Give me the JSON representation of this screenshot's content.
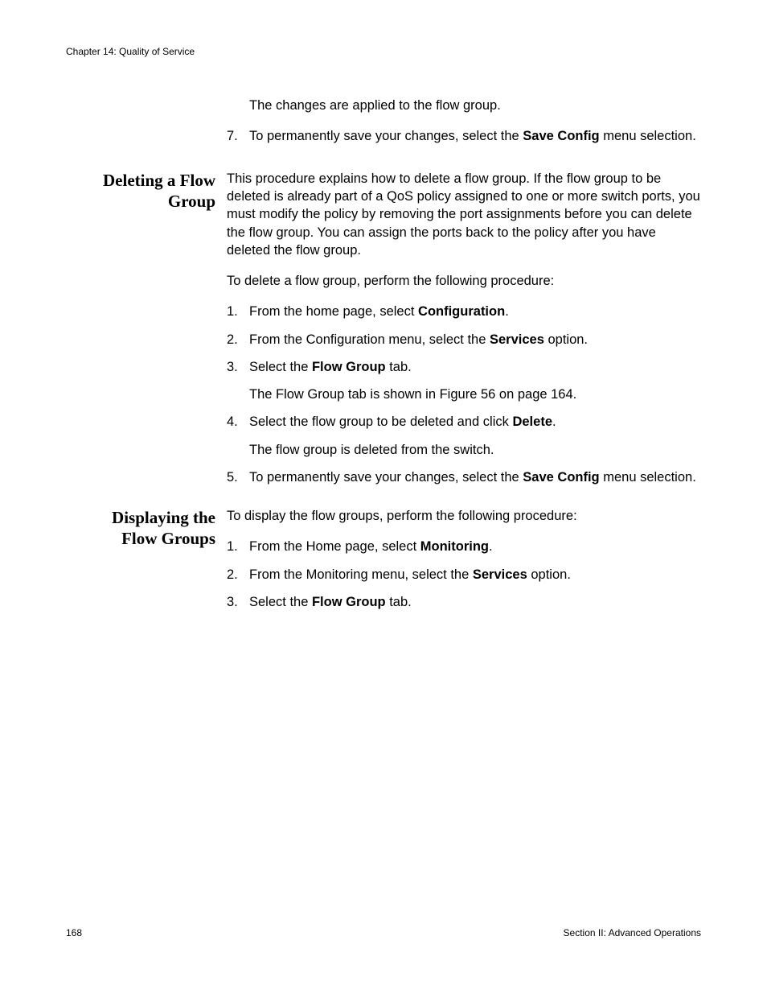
{
  "header": {
    "running": "Chapter 14: Quality of Service"
  },
  "intro": {
    "applied": "The changes are applied to the flow group.",
    "step7": {
      "num": "7.",
      "pre": "To permanently save your changes, select the ",
      "bold": "Save Config",
      "post": " menu selection."
    }
  },
  "section1": {
    "heading_l1": "Deleting a Flow",
    "heading_l2": "Group",
    "para": "This procedure explains how to delete a flow group. If the flow group to be deleted is already part of a QoS policy assigned to one or more switch ports, you must modify the policy by removing the port assignments before you can delete the flow group. You can assign the ports back to the policy after you have deleted the flow group.",
    "lead": "To delete a flow group, perform the following procedure:",
    "s1": {
      "num": "1.",
      "pre": "From the home page, select ",
      "bold": "Configuration",
      "post": "."
    },
    "s2": {
      "num": "2.",
      "pre": "From the Configuration menu, select the ",
      "bold": "Services",
      "post": " option."
    },
    "s3": {
      "num": "3.",
      "pre": "Select the ",
      "bold": "Flow Group",
      "post": " tab.",
      "sub": "The Flow Group tab is shown in Figure 56 on page 164."
    },
    "s4": {
      "num": "4.",
      "pre": "Select the flow group to be deleted and click ",
      "bold": "Delete",
      "post": ".",
      "sub": "The flow group is deleted from the switch."
    },
    "s5": {
      "num": "5.",
      "pre": "To permanently save your changes, select the ",
      "bold": "Save Config",
      "post": " menu selection."
    }
  },
  "section2": {
    "heading_l1": "Displaying the",
    "heading_l2": "Flow Groups",
    "lead": "To display the flow groups, perform the following procedure:",
    "s1": {
      "num": "1.",
      "pre": "From the Home page, select ",
      "bold": "Monitoring",
      "post": "."
    },
    "s2": {
      "num": "2.",
      "pre": "From the Monitoring menu, select the ",
      "bold": "Services",
      "post": " option."
    },
    "s3": {
      "num": "3.",
      "pre": "Select the ",
      "bold": "Flow Group",
      "post": " tab."
    }
  },
  "footer": {
    "page": "168",
    "section": "Section II: Advanced Operations"
  }
}
